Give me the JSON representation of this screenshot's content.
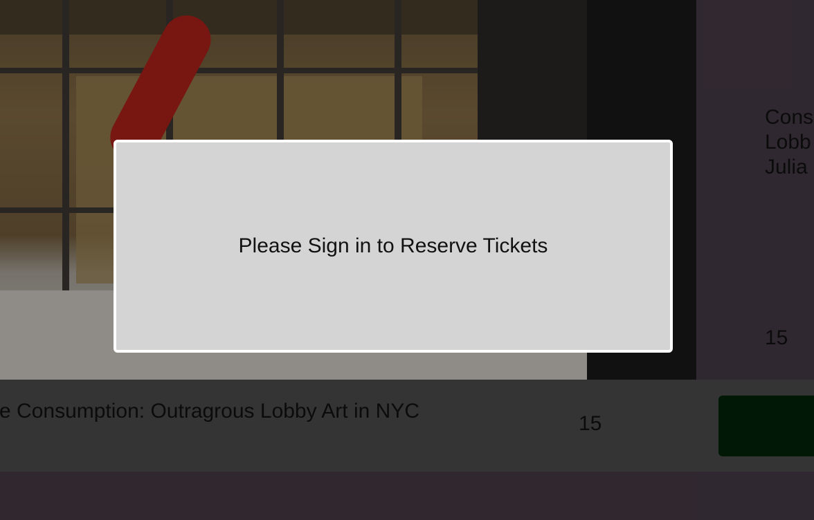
{
  "event": {
    "title": "Corporate Consumption: Outragrous Lobby Art in NYC",
    "title_visible": "ate Consumption: Outragrous Lobby Art in NYC",
    "count": "15"
  },
  "right_card": {
    "lines": [
      "Cons",
      "Lobb",
      "Julia"
    ],
    "count": "15"
  },
  "modal": {
    "message": "Please Sign in to Reserve Tickets"
  },
  "colors": {
    "page_bg": "#4a3d49",
    "info_bar": "#515151",
    "reserve_button": "#03260a",
    "modal_bg": "#d4d4d4",
    "modal_border": "#ffffff"
  }
}
